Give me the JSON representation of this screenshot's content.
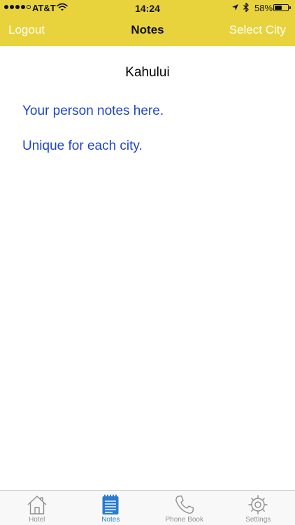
{
  "status_bar": {
    "carrier": "AT&T",
    "time": "14:24",
    "battery_percent": "58%",
    "battery_level": 0.58,
    "signal_bars_filled": 4,
    "signal_bars_total": 5
  },
  "nav": {
    "left_label": "Logout",
    "title": "Notes",
    "right_label": "Select City"
  },
  "content": {
    "city": "Kahului",
    "notes": [
      "Your person notes here.",
      "Unique for each city."
    ]
  },
  "tabs": [
    {
      "label": "Hotel",
      "icon": "house-icon",
      "active": false
    },
    {
      "label": "Notes",
      "icon": "notepad-icon",
      "active": true
    },
    {
      "label": "Phone Book",
      "icon": "phone-icon",
      "active": false
    },
    {
      "label": "Settings",
      "icon": "gear-icon",
      "active": false
    }
  ],
  "colors": {
    "header_background": "#e9d33d",
    "note_text": "#1f45c7",
    "tab_active": "#2a7bd3",
    "tab_inactive": "#929292"
  }
}
